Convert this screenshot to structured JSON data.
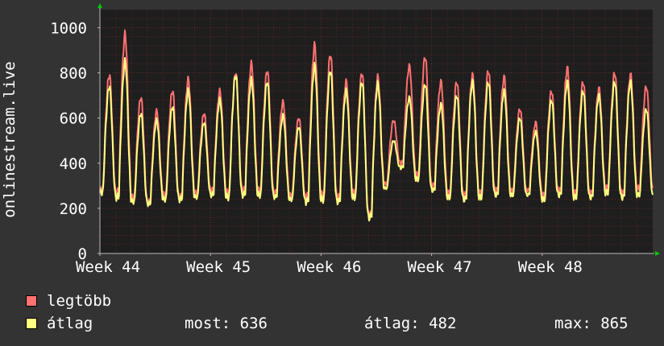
{
  "chart_data": {
    "type": "line",
    "ylabel": "onlinestream.live",
    "ylim": [
      0,
      1080
    ],
    "y_ticks": [
      0,
      200,
      400,
      600,
      800,
      1000
    ],
    "y_tick_labels": [
      "0",
      "200",
      "400",
      "600",
      "800",
      "1000"
    ],
    "x_range": [
      0,
      35
    ],
    "x_ticks": [
      {
        "label": "Week 44",
        "x": 0
      },
      {
        "label": "Week 45",
        "x": 7
      },
      {
        "label": "Week 46",
        "x": 14
      },
      {
        "label": "Week 47",
        "x": 21
      },
      {
        "label": "Week 48",
        "x": 28
      }
    ],
    "grid": true,
    "colors": {
      "background": "#333333",
      "plot_bg": "#1e1e1e",
      "grid_minor": "#5a2424",
      "grid_major": "#6a2a2a",
      "text": "#ffffff",
      "axis_arrow": "#00cc00"
    },
    "series": [
      {
        "name": "legtöbb",
        "color": "#ff7070",
        "daily_peaks": [
          790,
          970,
          690,
          630,
          720,
          770,
          620,
          720,
          800,
          840,
          810,
          670,
          600,
          920,
          880,
          760,
          800,
          780,
          590,
          830,
          870,
          760,
          760,
          790,
          810,
          780,
          640,
          580,
          720,
          820,
          760,
          730,
          800,
          790,
          740
        ],
        "daily_troughs": [
          280,
          270,
          250,
          230,
          260,
          250,
          270,
          280,
          270,
          280,
          280,
          270,
          260,
          250,
          260,
          250,
          270,
          170,
          310,
          400,
          350,
          300,
          270,
          260,
          270,
          280,
          280,
          280,
          260,
          280,
          270,
          270,
          290,
          270,
          290
        ]
      },
      {
        "name": "átlag",
        "color": "#ffff80",
        "daily_peaks": [
          740,
          850,
          620,
          590,
          650,
          720,
          580,
          680,
          790,
          770,
          760,
          610,
          560,
          830,
          810,
          720,
          760,
          750,
          500,
          690,
          750,
          660,
          700,
          760,
          760,
          720,
          600,
          540,
          680,
          760,
          720,
          700,
          760,
          760,
          640
        ],
        "daily_troughs": [
          270,
          250,
          230,
          220,
          240,
          240,
          250,
          260,
          250,
          260,
          260,
          250,
          240,
          230,
          240,
          230,
          250,
          160,
          290,
          380,
          330,
          280,
          250,
          240,
          250,
          260,
          260,
          260,
          240,
          260,
          250,
          250,
          270,
          250,
          260
        ]
      }
    ]
  },
  "legend": {
    "items": [
      {
        "label": "legtöbb",
        "color": "#ff7070"
      },
      {
        "label": "átlag",
        "color": "#ffff80"
      }
    ]
  },
  "stats": {
    "now": "most: 636",
    "avg": "átlag: 482",
    "max": "max: 865"
  }
}
